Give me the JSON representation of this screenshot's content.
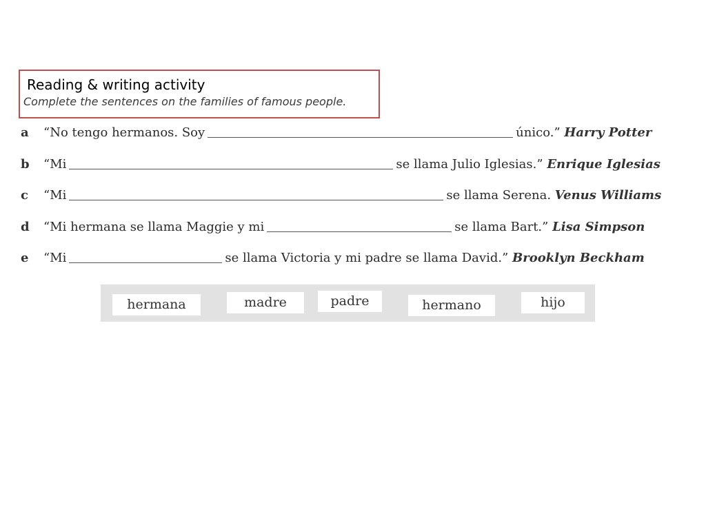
{
  "header": {
    "title": "Reading & writing activity",
    "instruction": "Complete the sentences on the families of famous people."
  },
  "sentences": [
    {
      "letter": "a",
      "before": "“No tengo hermanos. Soy",
      "after": "único.”",
      "person": "Harry Potter"
    },
    {
      "letter": "b",
      "before": "“Mi",
      "after": "se llama Julio Iglesias.”",
      "person": "Enrique Iglesias"
    },
    {
      "letter": "c",
      "before": "“Mi",
      "after": "se llama Serena.",
      "person": "Venus Williams"
    },
    {
      "letter": "d",
      "before": "“Mi hermana se llama Maggie y mi",
      "after": "se llama Bart.”",
      "person": "Lisa Simpson"
    },
    {
      "letter": "e",
      "before": "“Mi",
      "after": "se llama Victoria y mi padre se llama David.”",
      "person": "Brooklyn Beckham"
    }
  ],
  "word_bank": [
    "hermana",
    "madre",
    "padre",
    "hermano",
    "hijo"
  ]
}
